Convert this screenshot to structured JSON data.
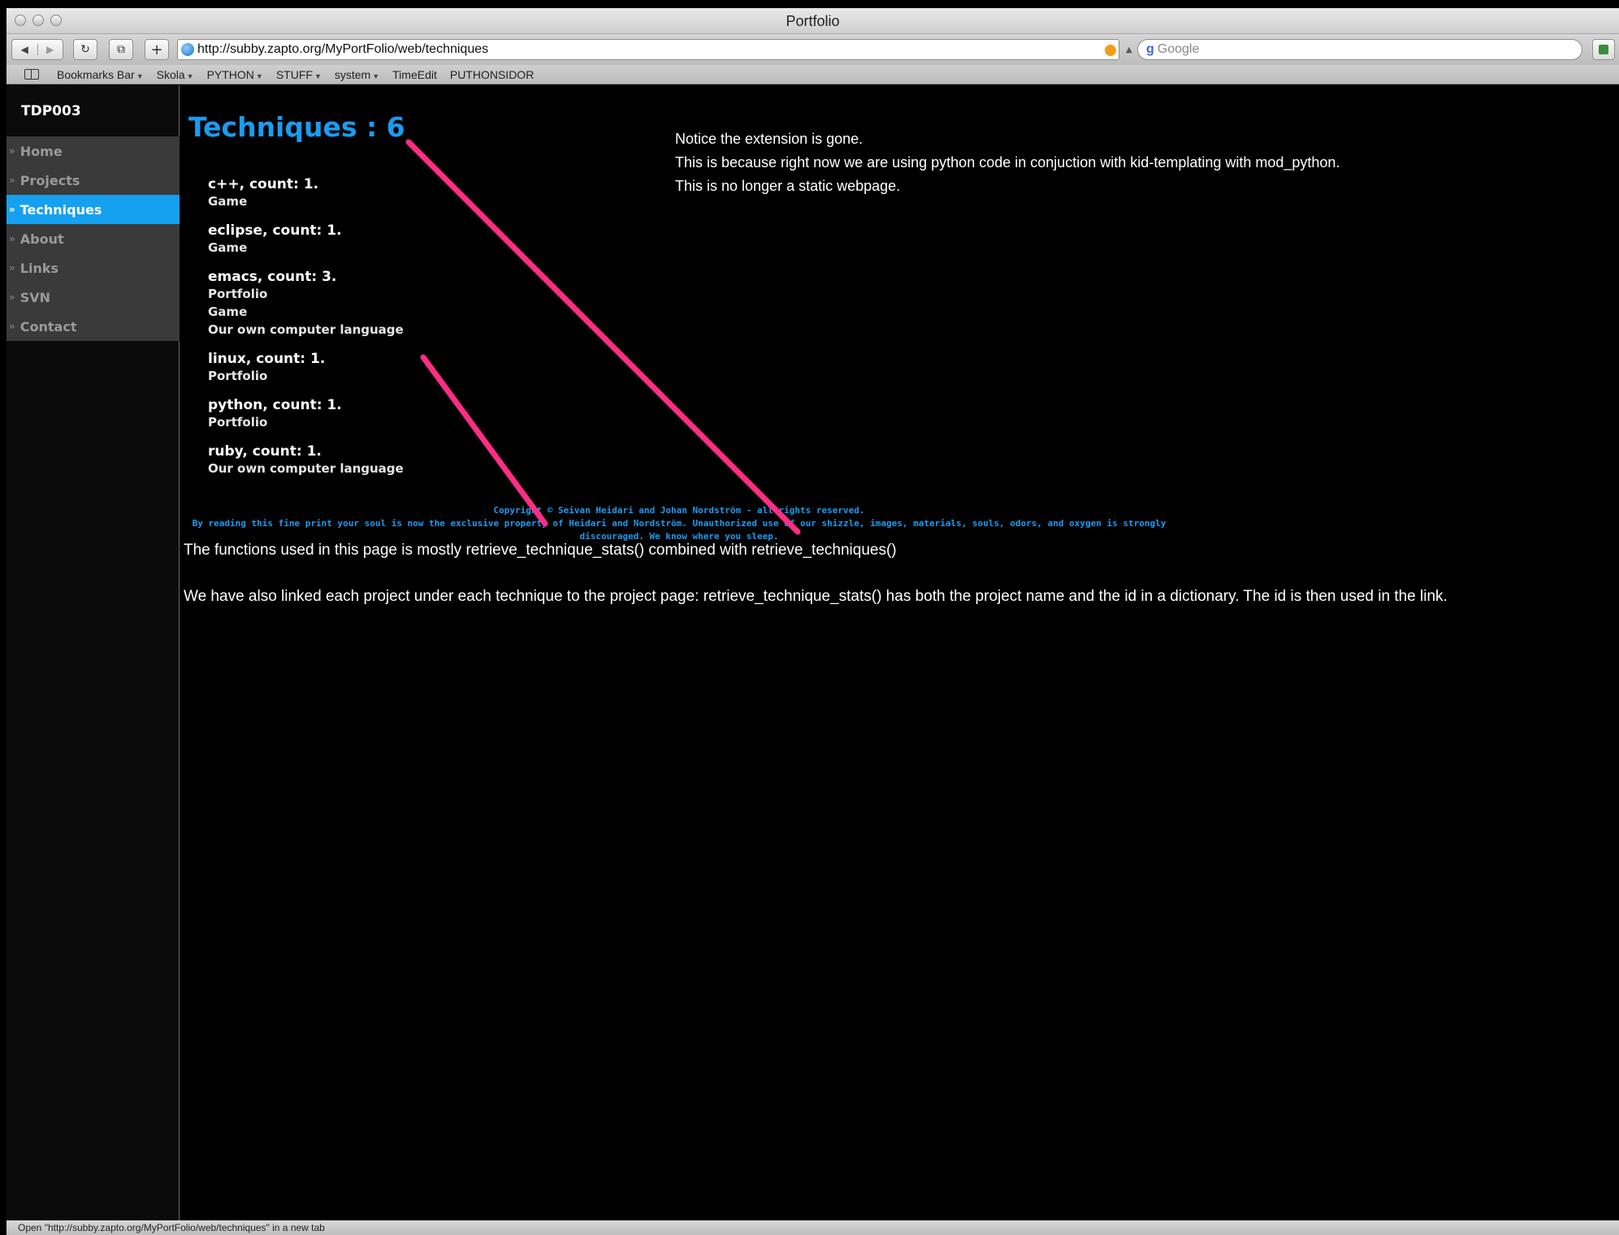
{
  "window": {
    "title": "Portfolio"
  },
  "toolbar": {
    "url": "http://subby.zapto.org/MyPortFolio/web/techniques",
    "search_placeholder": "Google",
    "back_icon": "back-arrow-icon",
    "forward_icon": "forward-arrow-icon"
  },
  "bookmarks": [
    {
      "label": "Bookmarks Bar",
      "has_menu": true
    },
    {
      "label": "Skola",
      "has_menu": true
    },
    {
      "label": "PYTHON",
      "has_menu": true
    },
    {
      "label": "STUFF",
      "has_menu": true
    },
    {
      "label": "system",
      "has_menu": true
    },
    {
      "label": "TimeEdit",
      "has_menu": false
    },
    {
      "label": "PUTHONSIDOR",
      "has_menu": false
    }
  ],
  "sidebar": {
    "title": "TDP003",
    "items": [
      {
        "label": "Home",
        "active": false
      },
      {
        "label": "Projects",
        "active": false
      },
      {
        "label": "Techniques",
        "active": true
      },
      {
        "label": "About",
        "active": false
      },
      {
        "label": "Links",
        "active": false
      },
      {
        "label": "SVN",
        "active": false
      },
      {
        "label": "Contact",
        "active": false
      }
    ]
  },
  "main": {
    "heading": "Techniques : 6",
    "techniques": [
      {
        "name": "c++, count: 1.",
        "projects": [
          "Game"
        ]
      },
      {
        "name": "eclipse, count: 1.",
        "projects": [
          "Game"
        ]
      },
      {
        "name": "emacs, count: 3.",
        "projects": [
          "Portfolio",
          "Game",
          "Our own computer language"
        ]
      },
      {
        "name": "linux, count: 1.",
        "projects": [
          "Portfolio"
        ]
      },
      {
        "name": "python, count: 1.",
        "projects": [
          "Portfolio"
        ]
      },
      {
        "name": "ruby, count: 1.",
        "projects": [
          "Our own computer language"
        ]
      }
    ],
    "notice": [
      "Notice the extension is gone.",
      "This is because right now we are using python code in conjuction with kid-templating with mod_python.",
      "This is no longer a static webpage."
    ],
    "copyright_line1": "Copyright © Seivan Heidari and Johan Nordström - all rights reserved.",
    "copyright_line2": "By reading this fine print your soul is now the exclusive property of Heidari and Nordström. Unauthorized use of our shizzle, images, materials, souls, odors, and oxygen is strongly discouraged. We know where you sleep.",
    "functions_text": "The functions used in this page is mostly retrieve_technique_stats() combined with retrieve_techniques()",
    "link_text": "We have also linked each project under each technique to the project page: retrieve_technique_stats() has both the project name and the id in a dictionary. The id is then used in the link."
  },
  "annotation_color": "#ff2d84",
  "status": {
    "text": "Open \"http://subby.zapto.org/MyPortFolio/web/techniques\" in a new tab"
  }
}
